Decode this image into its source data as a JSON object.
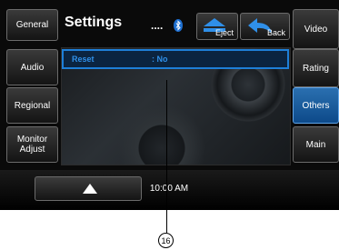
{
  "header": {
    "title": "Settings",
    "dots": "....",
    "bluetooth_icon": "bluetooth-icon"
  },
  "toolbar": {
    "eject_label": "Eject",
    "back_label": "Back"
  },
  "left_menu": [
    {
      "label": "General"
    },
    {
      "label": "Audio"
    },
    {
      "label": "Regional"
    },
    {
      "label": "Monitor\nAdjust"
    }
  ],
  "right_menu": [
    {
      "label": "Video"
    },
    {
      "label": "Rating"
    },
    {
      "label": "Others",
      "active": true
    },
    {
      "label": "Main"
    }
  ],
  "settings_list": {
    "reset_label": "Reset",
    "reset_value": ": No"
  },
  "status_bar": {
    "clock": "10:00 AM",
    "up_icon": "up-arrow-icon"
  },
  "annotation": {
    "callout_number": "16"
  },
  "colors": {
    "highlight": "#1e7fd8",
    "active_tab": "#1b5fa3",
    "background": "#0a0a0a"
  }
}
